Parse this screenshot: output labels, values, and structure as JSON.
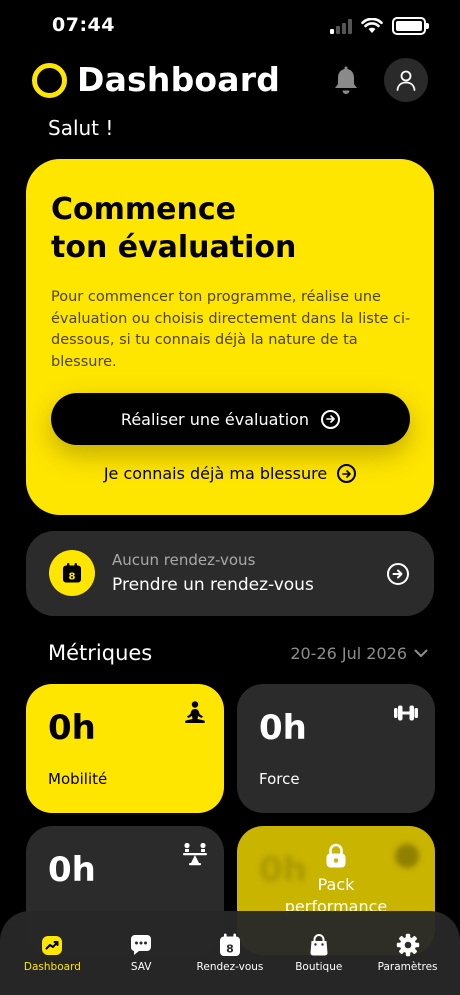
{
  "status": {
    "time": "07:44"
  },
  "header": {
    "title": "Dashboard"
  },
  "greeting": "Salut !",
  "hero": {
    "title_line1": "Commence",
    "title_line2": "ton évaluation",
    "description": "Pour commencer ton programme, réalise une évaluation ou choisis directement dans la liste ci-dessous, si tu connais déjà la nature de ta blessure.",
    "primary_button": "Réaliser une évaluation",
    "secondary_link": "Je connais déjà ma blessure"
  },
  "appointment": {
    "status": "Aucun rendez-vous",
    "action": "Prendre un rendez-vous",
    "calendar_day": "8"
  },
  "metrics": {
    "title": "Métriques",
    "range": "20-26 Jul 2026",
    "cards": [
      {
        "value": "0h",
        "label": "Mobilité",
        "icon": "meditation-icon"
      },
      {
        "value": "0h",
        "label": "Force",
        "icon": "dumbbell-icon"
      },
      {
        "value": "0h",
        "label": "",
        "icon": "balance-icon"
      },
      {
        "locked_label_1": "Pack",
        "locked_label_2": "performance",
        "value": "0h",
        "icon": "lock-icon"
      }
    ]
  },
  "nav": {
    "items": [
      {
        "label": "Dashboard",
        "icon": "chart-icon",
        "active": true
      },
      {
        "label": "SAV",
        "icon": "chat-icon",
        "active": false
      },
      {
        "label": "Rendez-vous",
        "icon": "calendar-icon",
        "active": false,
        "day": "8"
      },
      {
        "label": "Boutique",
        "icon": "bag-icon",
        "active": false
      },
      {
        "label": "Paramètres",
        "icon": "gear-icon",
        "active": false
      }
    ]
  },
  "colors": {
    "accent": "#ffe600",
    "card_dark": "#2b2b2b",
    "background": "#000000"
  }
}
